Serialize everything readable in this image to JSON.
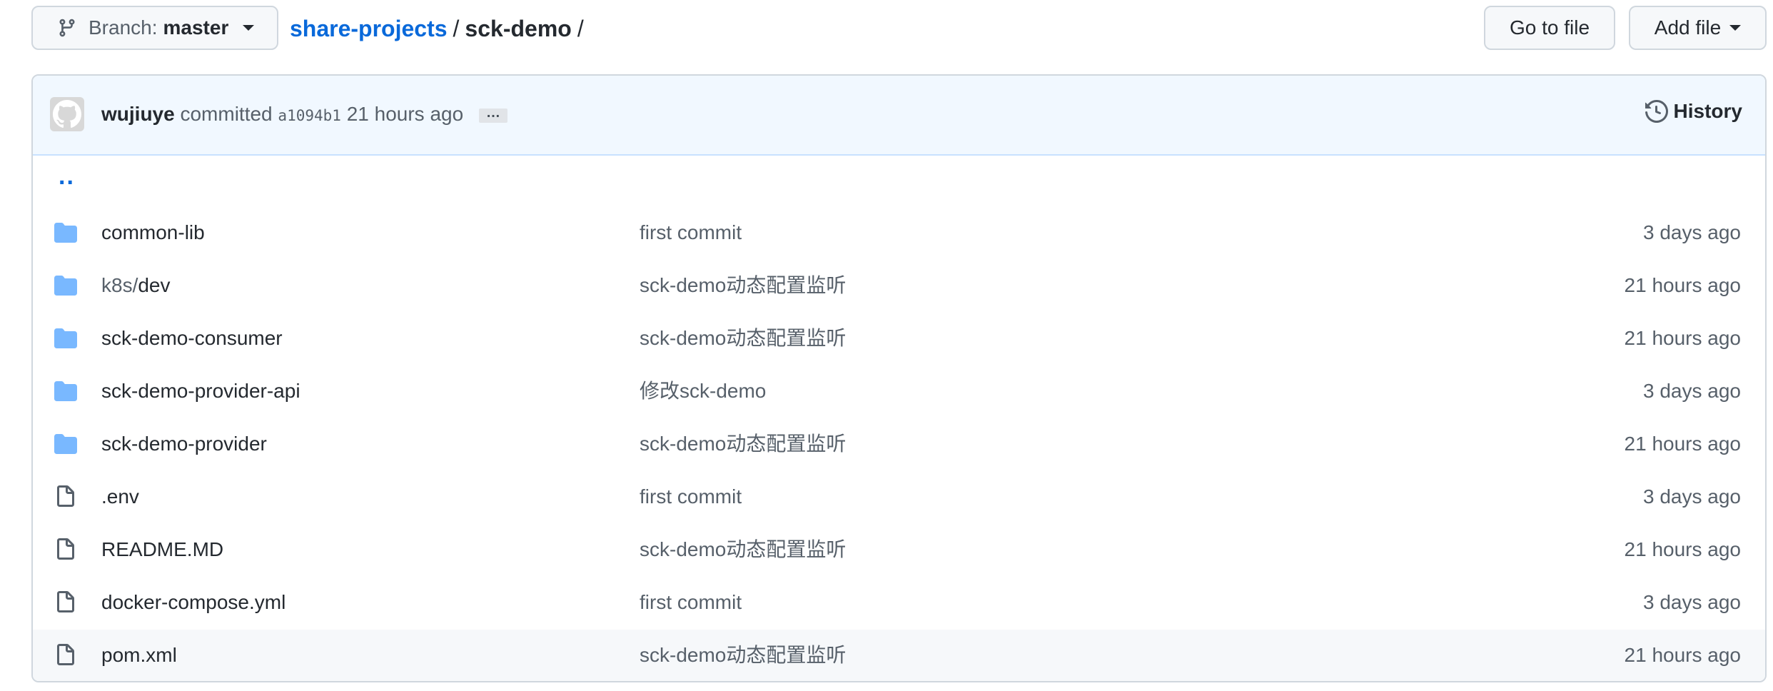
{
  "branch": {
    "label": "Branch:",
    "name": "master"
  },
  "breadcrumb": {
    "repo": "share-projects",
    "sep1": "/",
    "dir": "sck-demo",
    "sep2": "/"
  },
  "actions": {
    "goto_file": "Go to file",
    "add_file": "Add file"
  },
  "commit": {
    "author": "wujiuye",
    "verb": "committed",
    "sha": "a1094b1",
    "time": "21 hours ago",
    "ellipsis": "…",
    "history": "History"
  },
  "parent_dir": "..",
  "colors": {
    "link": "#0969da",
    "folder": "#79b8ff",
    "commit_bar": "#f1f8ff"
  },
  "files": [
    {
      "type": "folder",
      "prefix": "",
      "name": "common-lib",
      "message": "first commit",
      "age": "3 days ago"
    },
    {
      "type": "folder",
      "prefix": "k8s/",
      "name": "dev",
      "message": "sck-demo动态配置监听",
      "age": "21 hours ago"
    },
    {
      "type": "folder",
      "prefix": "",
      "name": "sck-demo-consumer",
      "message": "sck-demo动态配置监听",
      "age": "21 hours ago"
    },
    {
      "type": "folder",
      "prefix": "",
      "name": "sck-demo-provider-api",
      "message": "修改sck-demo",
      "age": "3 days ago"
    },
    {
      "type": "folder",
      "prefix": "",
      "name": "sck-demo-provider",
      "message": "sck-demo动态配置监听",
      "age": "21 hours ago"
    },
    {
      "type": "file",
      "prefix": "",
      "name": ".env",
      "message": "first commit",
      "age": "3 days ago"
    },
    {
      "type": "file",
      "prefix": "",
      "name": "README.MD",
      "message": "sck-demo动态配置监听",
      "age": "21 hours ago"
    },
    {
      "type": "file",
      "prefix": "",
      "name": "docker-compose.yml",
      "message": "first commit",
      "age": "3 days ago"
    },
    {
      "type": "file",
      "prefix": "",
      "name": "pom.xml",
      "message": "sck-demo动态配置监听",
      "age": "21 hours ago"
    }
  ]
}
